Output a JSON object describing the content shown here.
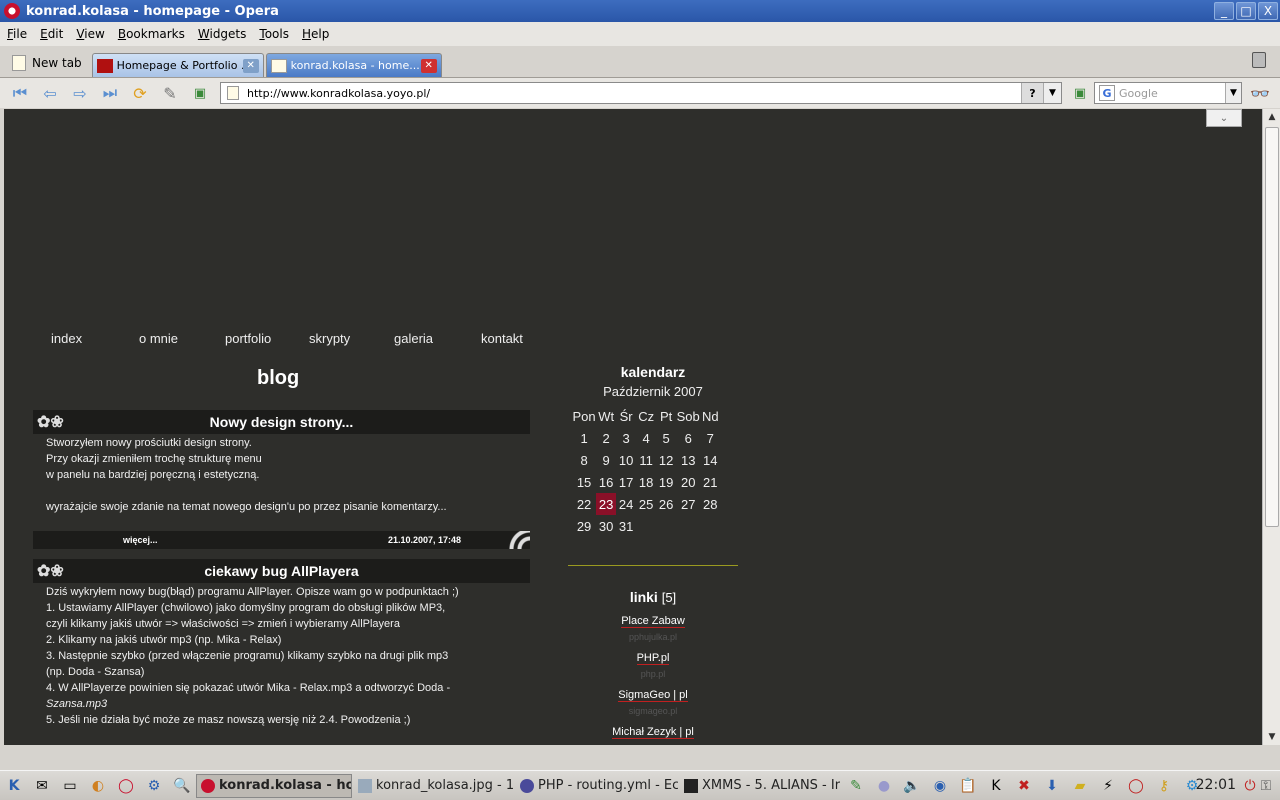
{
  "window": {
    "title": "konrad.kolasa - homepage - Opera",
    "controls": [
      "_",
      "□",
      "X"
    ]
  },
  "menu": [
    "File",
    "Edit",
    "View",
    "Bookmarks",
    "Widgets",
    "Tools",
    "Help"
  ],
  "tabs": {
    "new_tab": "New tab",
    "items": [
      {
        "label": "Homepage & Portfolio ...",
        "active": false
      },
      {
        "label": "konrad.kolasa - home...",
        "active": true
      }
    ]
  },
  "address": {
    "url": "http://www.konradkolasa.yoyo.pl/",
    "help": "?",
    "search_placeholder": "Google"
  },
  "site": {
    "nav": [
      "index",
      "o mnie",
      "portfolio",
      "skrypty",
      "galeria",
      "kontakt"
    ],
    "blog_title": "blog",
    "posts": [
      {
        "title": "Nowy design strony...",
        "lines": [
          "Stworzyłem nowy prościutki design strony.",
          "Przy okazji zmieniłem trochę strukturę menu",
          "w panelu na bardziej poręczną i estetyczną.",
          "",
          "wyrażajcie swoje zdanie na temat nowego design'u po przez pisanie komentarzy..."
        ],
        "more": "więcej...",
        "date": "21.10.2007, 17:48"
      },
      {
        "title": "ciekawy bug AllPlayera",
        "lines": [
          "Dziś wykryłem nowy bug(błąd) programu AllPlayer. Opisze wam go w podpunktach ;)",
          "1. Ustawiamy AllPlayer (chwilowo) jako domyślny program do obsługi plików MP3,",
          "czyli klikamy jakiś utwór => właściwości => zmień i wybieramy AllPlayera",
          "2. Klikamy na jakiś utwór mp3 (np. Mika - Relax)",
          "3. Następnie szybko (przed włączenie programu) klikamy szybko na drugi plik mp3",
          "(np. Doda - Szansa)",
          "4. W AllPlayerze powinien się pokazać utwór Mika - Relax.mp3 a odtworzyć Doda -",
          "Szansa.mp3",
          "5. Jeśli nie działa być może ze masz nowszą wersję niż 2.4. Powodzenia ;)"
        ]
      }
    ],
    "calendar": {
      "title": "kalendarz",
      "month": "Październik 2007",
      "weekdays": [
        "Pon",
        "Wt",
        "Śr",
        "Cz",
        "Pt",
        "Sob",
        "Nd"
      ],
      "weeks": [
        [
          "1",
          "2",
          "3",
          "4",
          "5",
          "6",
          "7"
        ],
        [
          "8",
          "9",
          "10",
          "11",
          "12",
          "13",
          "14"
        ],
        [
          "15",
          "16",
          "17",
          "18",
          "19",
          "20",
          "21"
        ],
        [
          "22",
          "23",
          "24",
          "25",
          "26",
          "27",
          "28"
        ],
        [
          "29",
          "30",
          "31",
          "",
          "",
          "",
          ""
        ]
      ],
      "today": "23"
    },
    "links": {
      "title": "linki",
      "count": "[5]",
      "items": [
        {
          "name": "Place Zabaw",
          "sub": "pphujulka.pl"
        },
        {
          "name": "PHP.pl",
          "sub": "php.pl"
        },
        {
          "name": "SigmaGeo | pl",
          "sub": "sigmageo.pl"
        },
        {
          "name": "Michał Zezyk | pl",
          "sub": ""
        }
      ]
    }
  },
  "taskbar": {
    "tasks": [
      {
        "label": "konrad.kolasa - hom",
        "active": true
      },
      {
        "label": "konrad_kolasa.jpg - 1",
        "active": false
      },
      {
        "label": "PHP - routing.yml - Ec",
        "active": false
      },
      {
        "label": "XMMS - 5. ALIANS - Ir",
        "active": false
      }
    ],
    "clock": "22:01"
  }
}
